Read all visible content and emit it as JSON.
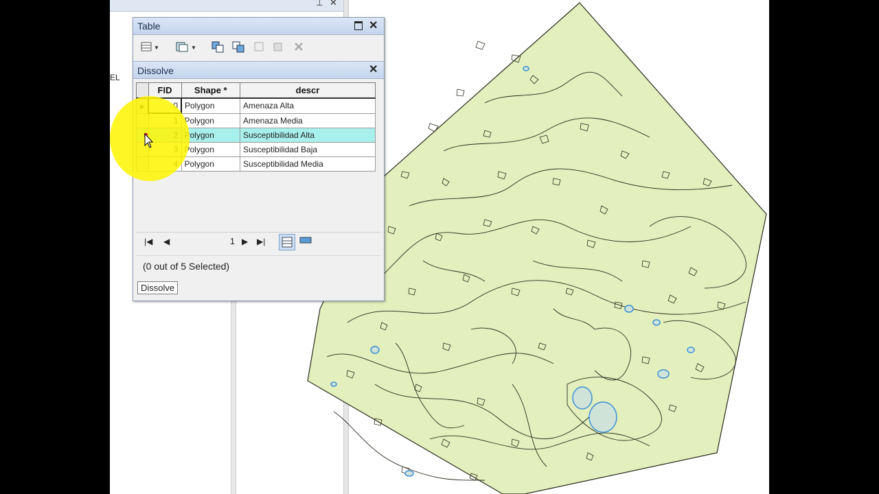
{
  "background": {
    "toc_fragment": "EL"
  },
  "table_window": {
    "title": "Table",
    "tab_label": "Dissolve",
    "columns": [
      "FID",
      "Shape *",
      "descr"
    ],
    "rows": [
      {
        "fid": "0",
        "shape": "Polygon",
        "descr": "Amenaza Alta"
      },
      {
        "fid": "1",
        "shape": "Polygon",
        "descr": "Amenaza Media"
      },
      {
        "fid": "2",
        "shape": "Polygon",
        "descr": "Susceptibilidad Alta"
      },
      {
        "fid": "3",
        "shape": "Polygon",
        "descr": "Susceptibilidad Baja"
      },
      {
        "fid": "4",
        "shape": "Polygon",
        "descr": "Susceptibilidad Media"
      }
    ],
    "current_record": "1",
    "status_text": "(0 out of 5 Selected)",
    "bottom_tab": "Dissolve"
  },
  "colors": {
    "map_fill": "#e3efbd",
    "map_line": "#2a2a1e",
    "water": "#3b8fd6",
    "row_highlight": "#a8f0ec",
    "cursor_highlight": "#fff500"
  },
  "icons": [
    "table-options-icon",
    "select-by-attributes-icon",
    "switch-selection-icon",
    "clear-selection-icon",
    "zoom-to-selected-icon",
    "delete-selected-icon",
    "first-record-icon",
    "previous-record-icon",
    "next-record-icon",
    "last-record-icon",
    "show-all-records-icon",
    "show-selected-records-icon"
  ]
}
